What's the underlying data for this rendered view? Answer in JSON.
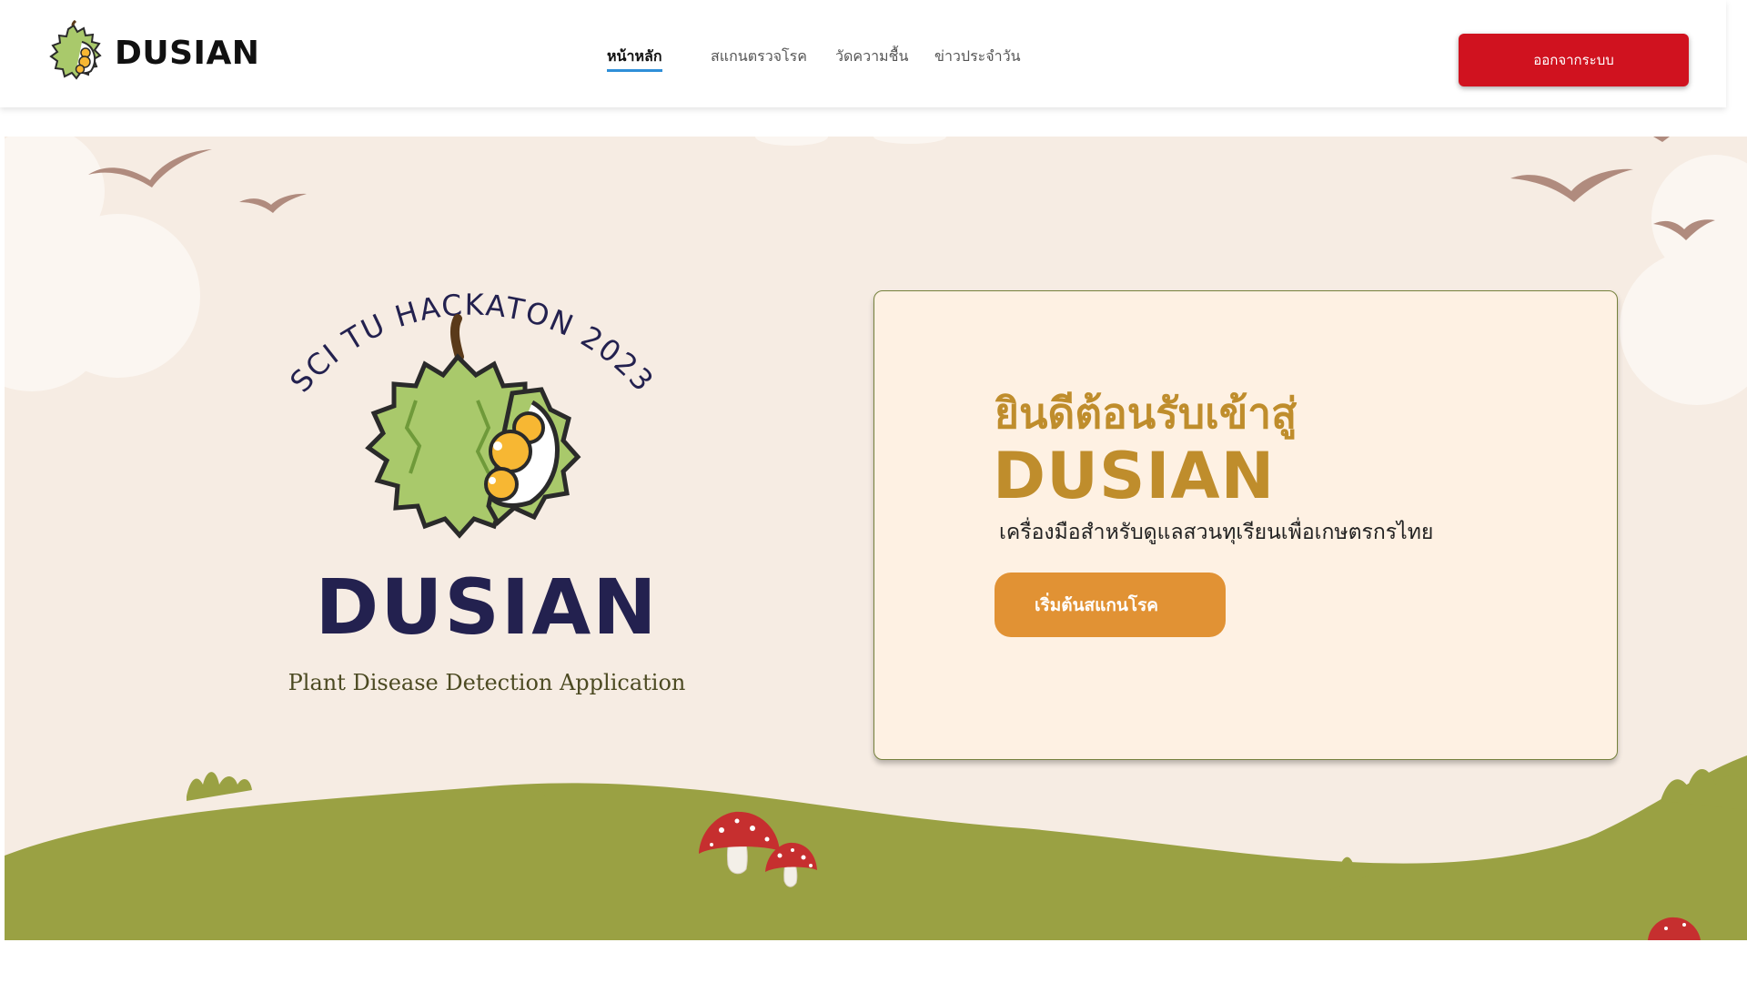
{
  "header": {
    "brand_name": "DUSIAN",
    "nav": [
      {
        "label": "หน้าหลัก",
        "active": true
      },
      {
        "label": "สแกนตรวจโรค",
        "active": false
      },
      {
        "label": "วัดความชื้น",
        "active": false
      },
      {
        "label": "ข่าวประจำวัน",
        "active": false
      }
    ],
    "logout_label": "ออกจากระบบ"
  },
  "hero": {
    "logo": {
      "arc_text": "SCI TU HACKATON 2023",
      "brand": "DUSIAN",
      "tagline": "Plant Disease Detection Application"
    },
    "card": {
      "title": "ยินดีต้อนรับเข้าสู่",
      "brand": "DUSIAN",
      "subtitle": "เครื่องมือสำหรับดูแลสวนทุเรียนเพื่อเกษตรกรไทย",
      "cta_label": "เริ่มต้นสแกนโรค"
    }
  },
  "colors": {
    "accent_gold": "#bf8d2c",
    "cta_orange": "#e19234",
    "logout_red": "#d0121f",
    "hill_green": "#9aa143",
    "card_bg": "#fef1e3",
    "hero_bg": "#f6ece3",
    "logo_navy": "#23214f"
  }
}
